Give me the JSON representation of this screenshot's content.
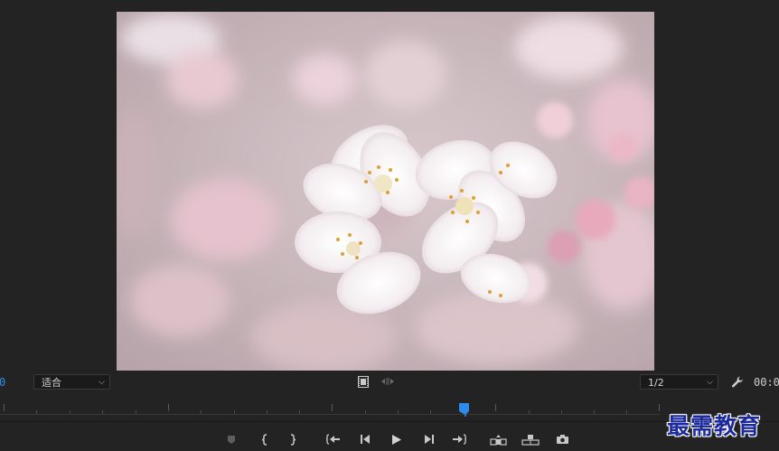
{
  "program_monitor": {
    "timecode_left": "0",
    "timecode_right": "00:0",
    "zoom": {
      "selected": "适合"
    },
    "resolution": {
      "selected": "1/2"
    }
  },
  "icons": {
    "export_frame_left": "film-frame-icon",
    "safe_margins": "arrows-icon",
    "settings": "wrench-icon"
  },
  "transport": {
    "buttons": [
      "add-marker",
      "mark-in",
      "mark-out",
      "go-to-in",
      "step-back",
      "play",
      "step-forward",
      "go-to-out",
      "lift",
      "extract",
      "export-frame"
    ]
  },
  "watermark": {
    "text": "最需教育"
  },
  "colors": {
    "background": "#232323",
    "timecode_accent": "#2d8ceb",
    "playhead": "#2d8ceb",
    "watermark": "#1d2a9c"
  }
}
